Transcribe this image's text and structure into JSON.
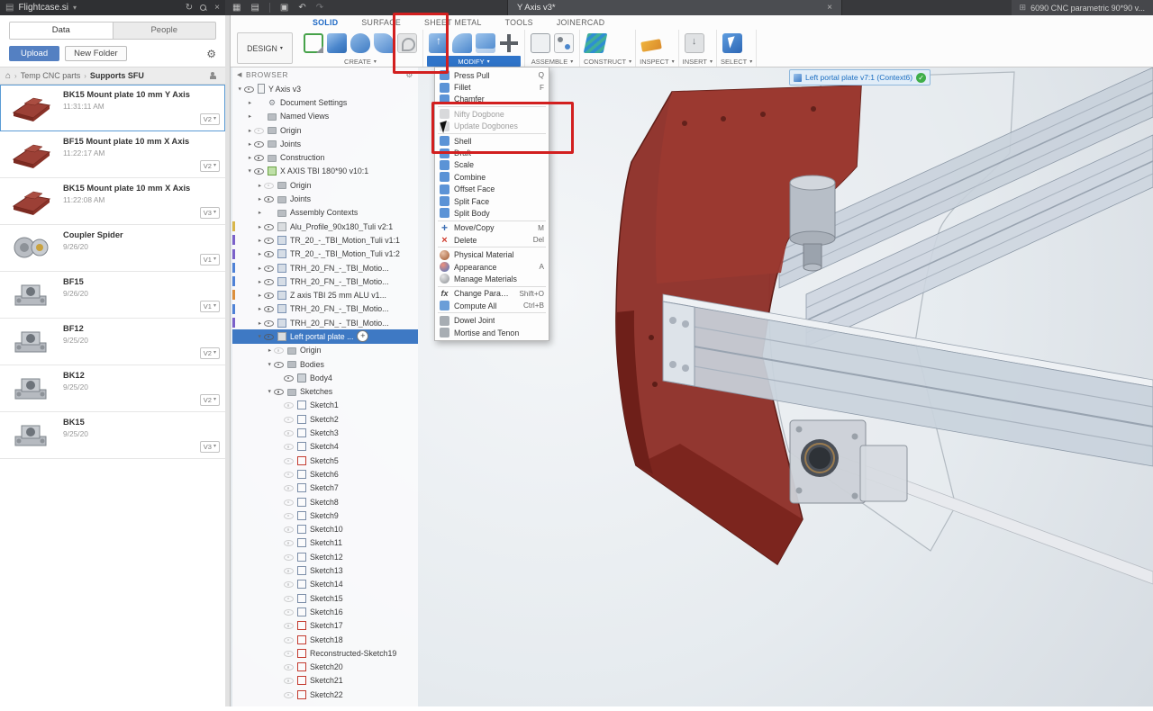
{
  "topbar": {
    "project_name": "Flightcase.si",
    "doc_tab": "Y Axis v3*",
    "right_doc": "6090 CNC parametric 90*90 v..."
  },
  "toolbar": {
    "design_label": "DESIGN",
    "tabs": [
      {
        "label": "SOLID",
        "active": true
      },
      {
        "label": "SURFACE",
        "active": false
      },
      {
        "label": "SHEET METAL",
        "active": false
      },
      {
        "label": "TOOLS",
        "active": false
      },
      {
        "label": "JOINERCAD",
        "active": false
      }
    ],
    "groups": [
      {
        "label": "CREATE"
      },
      {
        "label": "MODIFY",
        "active": true
      },
      {
        "label": "ASSEMBLE"
      },
      {
        "label": "CONSTRUCT"
      },
      {
        "label": "INSPECT"
      },
      {
        "label": "INSERT"
      },
      {
        "label": "SELECT"
      }
    ]
  },
  "data_panel": {
    "tabs": [
      {
        "label": "Data",
        "active": true
      },
      {
        "label": "People",
        "active": false
      }
    ],
    "upload_label": "Upload",
    "new_folder_label": "New Folder",
    "breadcrumb": {
      "root": "Temp CNC parts",
      "current": "Supports SFU"
    },
    "items": [
      {
        "name": "BK15 Mount plate 10 mm Y Axis",
        "date": "11:31:11 AM",
        "version": "V2",
        "thumb": "red-plate",
        "selected": true
      },
      {
        "name": "BF15 Mount plate 10 mm X Axis",
        "date": "11:22:17 AM",
        "version": "V2",
        "thumb": "red-plate"
      },
      {
        "name": "BK15 Mount plate 10 mm X Axis",
        "date": "11:22:08 AM",
        "version": "V3",
        "thumb": "red-plate"
      },
      {
        "name": "Coupler Spider",
        "date": "9/26/20",
        "version": "V1",
        "thumb": "coupler"
      },
      {
        "name": "BF15",
        "date": "9/26/20",
        "version": "V1",
        "thumb": "block"
      },
      {
        "name": "BF12",
        "date": "9/25/20",
        "version": "V2",
        "thumb": "block"
      },
      {
        "name": "BK12",
        "date": "9/25/20",
        "version": "V2",
        "thumb": "block"
      },
      {
        "name": "BK15",
        "date": "9/25/20",
        "version": "V3",
        "thumb": "block"
      }
    ]
  },
  "browser": {
    "title": "BROWSER",
    "tree": [
      {
        "label": "Y Axis v3",
        "depth": 0,
        "icon": "root",
        "expanded": true
      },
      {
        "label": "Document Settings",
        "depth": 1,
        "icon": "settings",
        "noEye": true
      },
      {
        "label": "Named Views",
        "depth": 1,
        "icon": "folder",
        "noEye": true
      },
      {
        "label": "Origin",
        "depth": 1,
        "icon": "folder",
        "eyeOff": true
      },
      {
        "label": "Joints",
        "depth": 1,
        "icon": "folder"
      },
      {
        "label": "Construction",
        "depth": 1,
        "icon": "folder"
      },
      {
        "label": "X AXIS TBI 180*90 v10:1",
        "depth": 1,
        "icon": "component-green",
        "expanded": true
      },
      {
        "label": "Origin",
        "depth": 2,
        "icon": "folder",
        "eyeOff": true
      },
      {
        "label": "Joints",
        "depth": 2,
        "icon": "folder"
      },
      {
        "label": "Assembly Contexts",
        "depth": 2,
        "icon": "folder",
        "noEye": true
      },
      {
        "label": "Alu_Profile_90x180_Tuli v2:1",
        "depth": 2,
        "icon": "component",
        "bar": "#d9b64a"
      },
      {
        "label": "TR_20_-_TBI_Motion_Tuli v1:1",
        "depth": 2,
        "icon": "component-link",
        "bar": "#7b61c9"
      },
      {
        "label": "TR_20_-_TBI_Motion_Tuli v1:2",
        "depth": 2,
        "icon": "component-link",
        "bar": "#7b61c9"
      },
      {
        "label": "TRH_20_FN_-_TBI_Motio...",
        "depth": 2,
        "icon": "component-link",
        "bar": "#4f82d6"
      },
      {
        "label": "TRH_20_FN_-_TBI_Motio...",
        "depth": 2,
        "icon": "component-link",
        "bar": "#4f82d6"
      },
      {
        "label": "Z axis TBI 25 mm ALU v1...",
        "depth": 2,
        "icon": "component-link",
        "bar": "#dc8f3d"
      },
      {
        "label": "TRH_20_FN_-_TBI_Motio...",
        "depth": 2,
        "icon": "component-link",
        "bar": "#4f82d6"
      },
      {
        "label": "TRH_20_FN_-_TBI_Motio...",
        "depth": 2,
        "icon": "component-link",
        "bar": "#7b61c9"
      },
      {
        "label": "Left portal plate ...",
        "depth": 2,
        "icon": "component",
        "selected": true,
        "plus": true,
        "expanded": true
      },
      {
        "label": "Origin",
        "depth": 3,
        "icon": "folder",
        "eyeOff": true
      },
      {
        "label": "Bodies",
        "depth": 3,
        "icon": "folder",
        "expanded": true
      },
      {
        "label": "Body4",
        "depth": 4,
        "icon": "body",
        "leaf": true
      },
      {
        "label": "Sketches",
        "depth": 3,
        "icon": "folder",
        "expanded": true
      },
      {
        "label": "Sketch1",
        "depth": 4,
        "icon": "sketch",
        "leaf": true,
        "eyeOff": true
      },
      {
        "label": "Sketch2",
        "depth": 4,
        "icon": "sketch",
        "leaf": true,
        "eyeOff": true
      },
      {
        "label": "Sketch3",
        "depth": 4,
        "icon": "sketch",
        "leaf": true,
        "eyeOff": true
      },
      {
        "label": "Sketch4",
        "depth": 4,
        "icon": "sketch",
        "leaf": true,
        "eyeOff": true
      },
      {
        "label": "Sketch5",
        "depth": 4,
        "icon": "sketch-red",
        "leaf": true,
        "eyeOff": true
      },
      {
        "label": "Sketch6",
        "depth": 4,
        "icon": "sketch",
        "leaf": true,
        "eyeOff": true
      },
      {
        "label": "Sketch7",
        "depth": 4,
        "icon": "sketch",
        "leaf": true,
        "eyeOff": true
      },
      {
        "label": "Sketch8",
        "depth": 4,
        "icon": "sketch",
        "leaf": true,
        "eyeOff": true
      },
      {
        "label": "Sketch9",
        "depth": 4,
        "icon": "sketch",
        "leaf": true,
        "eyeOff": true
      },
      {
        "label": "Sketch10",
        "depth": 4,
        "icon": "sketch",
        "leaf": true,
        "eyeOff": true
      },
      {
        "label": "Sketch11",
        "depth": 4,
        "icon": "sketch",
        "leaf": true,
        "eyeOff": true
      },
      {
        "label": "Sketch12",
        "depth": 4,
        "icon": "sketch",
        "leaf": true,
        "eyeOff": true
      },
      {
        "label": "Sketch13",
        "depth": 4,
        "icon": "sketch",
        "leaf": true,
        "eyeOff": true
      },
      {
        "label": "Sketch14",
        "depth": 4,
        "icon": "sketch",
        "leaf": true,
        "eyeOff": true
      },
      {
        "label": "Sketch15",
        "depth": 4,
        "icon": "sketch",
        "leaf": true,
        "eyeOff": true
      },
      {
        "label": "Sketch16",
        "depth": 4,
        "icon": "sketch",
        "leaf": true,
        "eyeOff": true
      },
      {
        "label": "Sketch17",
        "depth": 4,
        "icon": "sketch-red",
        "leaf": true,
        "eyeOff": true
      },
      {
        "label": "Sketch18",
        "depth": 4,
        "icon": "sketch-red",
        "leaf": true,
        "eyeOff": true
      },
      {
        "label": "Reconstructed-Sketch19",
        "depth": 4,
        "icon": "sketch-red",
        "leaf": true,
        "eyeOff": true
      },
      {
        "label": "Sketch20",
        "depth": 4,
        "icon": "sketch-red",
        "leaf": true,
        "eyeOff": true
      },
      {
        "label": "Sketch21",
        "depth": 4,
        "icon": "sketch-red",
        "leaf": true,
        "eyeOff": true
      },
      {
        "label": "Sketch22",
        "depth": 4,
        "icon": "sketch-red",
        "leaf": true,
        "eyeOff": true
      }
    ]
  },
  "modify_menu": {
    "items": [
      {
        "label": "Press Pull",
        "shortcut": "Q",
        "icon": "press-pull-icon"
      },
      {
        "label": "Fillet",
        "shortcut": "F",
        "icon": "fillet-icon"
      },
      {
        "label": "Chamfer",
        "icon": "chamfer-icon"
      },
      {
        "separator": true
      },
      {
        "label": "Nifty Dogbone",
        "icon": "nifty-dogbone-icon",
        "disabled": true
      },
      {
        "label": "Update Dogbones",
        "icon": "update-dogbones-icon",
        "disabled": true
      },
      {
        "separator": true
      },
      {
        "label": "Shell",
        "icon": "shell-icon"
      },
      {
        "label": "Draft",
        "icon": "draft-icon"
      },
      {
        "label": "Scale",
        "icon": "scale-icon"
      },
      {
        "label": "Combine",
        "icon": "combine-icon"
      },
      {
        "label": "Offset Face",
        "icon": "offset-face-icon"
      },
      {
        "label": "Split Face",
        "icon": "split-face-icon"
      },
      {
        "label": "Split Body",
        "icon": "split-body-icon"
      },
      {
        "separator": true
      },
      {
        "label": "Move/Copy",
        "shortcut": "M",
        "icon": "move-copy-icon"
      },
      {
        "label": "Delete",
        "shortcut": "Del",
        "icon": "delete-icon"
      },
      {
        "separator": true
      },
      {
        "label": "Physical Material",
        "icon": "physical-material-icon"
      },
      {
        "label": "Appearance",
        "shortcut": "A",
        "icon": "appearance-icon"
      },
      {
        "label": "Manage Materials",
        "icon": "manage-materials-icon"
      },
      {
        "separator": true
      },
      {
        "label": "Change Parameters",
        "shortcut": "Shift+O",
        "icon": "change-parameters-icon"
      },
      {
        "label": "Compute All",
        "shortcut": "Ctrl+B",
        "icon": "compute-all-icon"
      },
      {
        "separator": true
      },
      {
        "label": "Dowel Joint",
        "icon": "dowel-joint-icon"
      },
      {
        "label": "Mortise and Tenon",
        "icon": "mortise-and-tenon-icon"
      }
    ]
  },
  "canvas": {
    "badge": {
      "label": "Left portal plate v7:1 (Context6)"
    }
  },
  "colors": {
    "accent_blue": "#2f74c9",
    "annotation_red": "#d21f1f",
    "selection_blue": "#3e79c4",
    "plate_red": "#8e2f28"
  }
}
